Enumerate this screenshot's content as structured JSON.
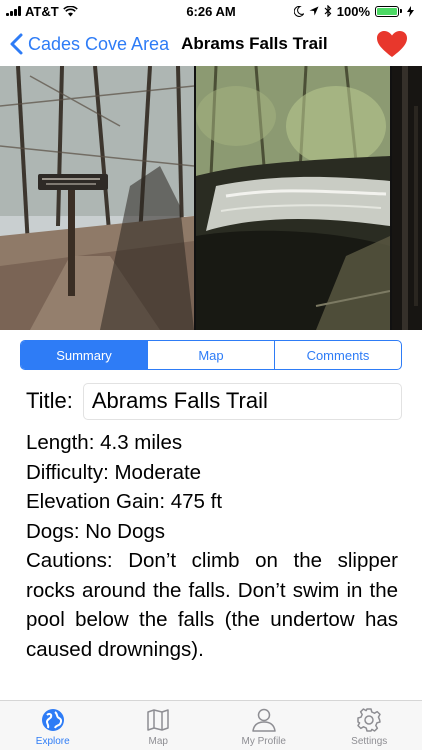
{
  "status_bar": {
    "carrier": "AT&T",
    "time": "6:26 AM",
    "battery": "100%"
  },
  "nav": {
    "back_label": "Cades Cove Area",
    "title": "Abrams Falls Trail",
    "favorite_color": "#e8372c"
  },
  "tabs_segment": [
    "Summary",
    "Map",
    "Comments"
  ],
  "details": {
    "title_label": "Title:",
    "title_value": "Abrams Falls Trail",
    "length": "Length: 4.3 miles",
    "difficulty": "Difficulty: Moderate",
    "elevation": "Elevation Gain: 475 ft",
    "dogs": "Dogs:  No Dogs",
    "cautions": "Cautions: Don’t climb on the slipper rocks around the falls. Don’t swim in the pool below the falls (the undertow has caused drownings)."
  },
  "tab_bar": {
    "items": [
      {
        "label": "Explore",
        "icon": "globe-icon"
      },
      {
        "label": "Map",
        "icon": "map-icon"
      },
      {
        "label": "My Profile",
        "icon": "person-icon"
      },
      {
        "label": "Settings",
        "icon": "gear-icon"
      }
    ]
  },
  "colors": {
    "accent": "#2e7cf6",
    "heart": "#e8372c"
  }
}
